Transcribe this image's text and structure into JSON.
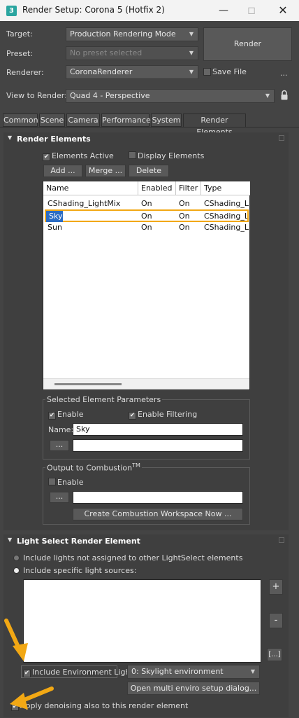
{
  "window": {
    "title": "Render Setup: Corona 5 (Hotfix 2)",
    "app_icon_letter": "3",
    "minimize_icon": "minimize-icon",
    "maximize_icon": "maximize-icon",
    "close_icon": "close-icon"
  },
  "top": {
    "target_label": "Target:",
    "target_value": "Production Rendering Mode",
    "preset_label": "Preset:",
    "preset_value": "No preset selected",
    "renderer_label": "Renderer:",
    "renderer_value": "CoronaRenderer",
    "save_file_label": "Save File",
    "render_button": "Render",
    "more_label": "...",
    "view_label": "View to Render:",
    "view_value": "Quad 4 - Perspective"
  },
  "tabs": [
    "Common",
    "Scene",
    "Camera",
    "Performance",
    "System",
    "Render Elements"
  ],
  "render_elements": {
    "header": "Render Elements",
    "elements_active": "Elements Active",
    "display_elements": "Display Elements",
    "add_button": "Add ...",
    "merge_button": "Merge ...",
    "delete_button": "Delete",
    "columns": [
      "Name",
      "Enabled",
      "Filter",
      "Type"
    ],
    "rows": [
      {
        "name": "CShading_LightMix",
        "enabled": "On",
        "filter": "On",
        "type": "CShading_Lig..."
      },
      {
        "name": "Sky",
        "enabled": "On",
        "filter": "On",
        "type": "CShading_Lig..."
      },
      {
        "name": "Sun",
        "enabled": "On",
        "filter": "On",
        "type": "CShading_Lig..."
      }
    ],
    "selected_params_title": "Selected Element Parameters",
    "enable_label": "Enable",
    "enable_filtering_label": "Enable Filtering",
    "name_label": "Name:",
    "name_value": "Sky",
    "browse_button": "...",
    "combustion_title": "Output to Combustion",
    "combustion_tm": "TM",
    "combustion_enable": "Enable",
    "create_workspace_button": "Create Combustion Workspace Now ..."
  },
  "light_select": {
    "header": "Light Select Render Element",
    "option_not_assigned": "Include lights not assigned to other LightSelect elements",
    "option_specific": "Include specific light sources:",
    "plus_button": "+",
    "minus_button": "-",
    "ellipsis_button": "[...]",
    "include_env_light": "Include Environment Light",
    "env_dropdown_value": "0: Skylight environment",
    "multi_enviro_button": "Open multi enviro setup dialog...",
    "apply_denoising": "Apply denoising also to this render element"
  },
  "colors": {
    "annotation": "#f2a814",
    "background": "#444444"
  }
}
